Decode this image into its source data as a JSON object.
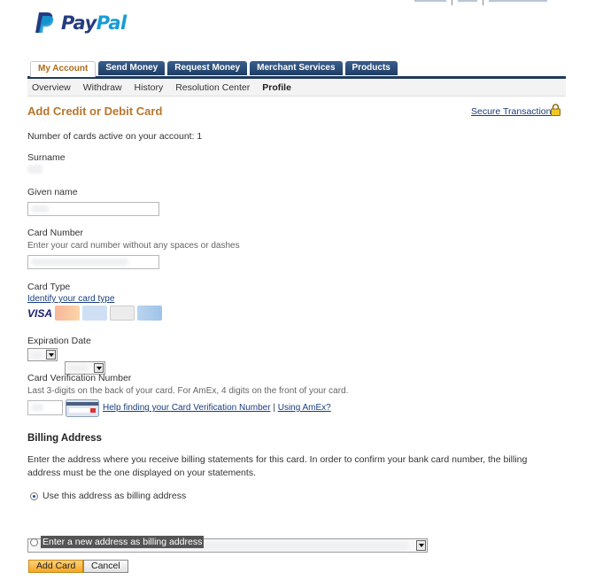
{
  "brand": {
    "name_part1": "Pay",
    "name_part2": "Pal"
  },
  "tabs": [
    {
      "label": "My Account",
      "active": true
    },
    {
      "label": "Send Money",
      "active": false
    },
    {
      "label": "Request Money",
      "active": false
    },
    {
      "label": "Merchant Services",
      "active": false
    },
    {
      "label": "Products",
      "active": false
    }
  ],
  "subnav": [
    {
      "label": "Overview"
    },
    {
      "label": "Withdraw"
    },
    {
      "label": "History"
    },
    {
      "label": "Resolution Center"
    },
    {
      "label": "Profile",
      "current": true
    }
  ],
  "page": {
    "title": "Add Credit or Debit Card",
    "secure_link": "Secure Transaction",
    "cards_active_text": "Number of cards active on your account: 1"
  },
  "form": {
    "surname_label": "Surname",
    "given_name_label": "Given name",
    "card_number_label": "Card Number",
    "card_number_help": "Enter your card number without any spaces or dashes",
    "card_type_label": "Card Type",
    "identify_link": "Identify your card type",
    "card_logos": [
      "visa-logo",
      "mastercard-logo",
      "amex-logo",
      "discover-logo",
      "other-card-logo"
    ],
    "visa_text": "VISA",
    "expiration_label": "Expiration Date",
    "cvv_label": "Card Verification Number",
    "cvv_help": "Last 3-digits on the back of your card. For AmEx, 4 digits on the front of your card.",
    "cvv_help_link": "Help finding your Card Verification Number",
    "cvv_separator": "|",
    "amex_link": "Using AmEx?"
  },
  "billing": {
    "title": "Billing Address",
    "description": "Enter the address where you receive billing statements for this card. In order to confirm your bank card number, the billing address must be the one displayed on your statements.",
    "option_existing": "Use this address as billing address",
    "option_new": "Enter a new address as billing address",
    "selected": "existing"
  },
  "buttons": {
    "add_card": "Add Card",
    "cancel": "Cancel"
  },
  "colors": {
    "accent": "#b8762b",
    "nav": "#1f3a5c",
    "link": "#1a3d7c",
    "paypal_dark": "#253b80",
    "paypal_light": "#179bd7"
  }
}
